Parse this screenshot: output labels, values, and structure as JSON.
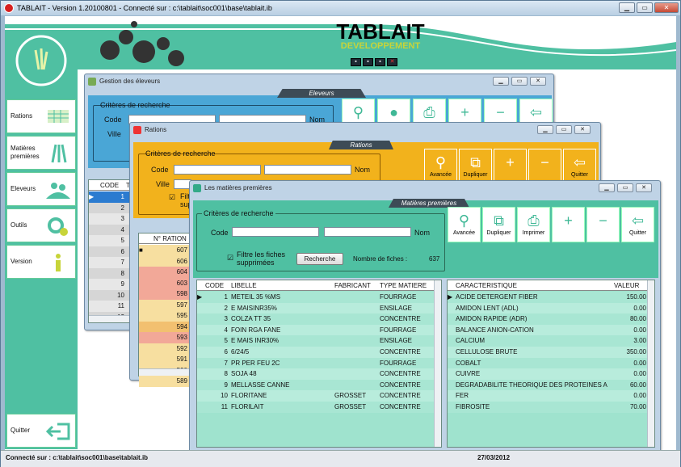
{
  "app": {
    "title": "TABLAIT - Version 1.20100801 - Connecté sur : c:\\tablait\\soc001\\base\\tablait.ib",
    "brand": "TABLAIT",
    "subtitle": "DEVELOPPEMENT",
    "accent_color": "#4fc0a2",
    "win_buttons": [
      "▁",
      "▭",
      "✕"
    ]
  },
  "sidebar": {
    "items": [
      {
        "label": "Rations",
        "icon": "grid-chart-icon"
      },
      {
        "label": "Matières premières",
        "icon": "wheat-icon"
      },
      {
        "label": "Eleveurs",
        "icon": "farmers-icon"
      },
      {
        "label": "Outils",
        "icon": "gears-icon"
      },
      {
        "label": "Version",
        "icon": "info-icon"
      }
    ],
    "quit_label": "Quitter"
  },
  "status": {
    "left": "Connecté sur : c:\\tablait\\soc001\\base\\tablait.ib",
    "date": "27/03/2012"
  },
  "eleveurs": {
    "title": "Gestion des éleveurs",
    "tab": "Eleveurs",
    "criteria": "Critères de recherche",
    "code_label": "Code",
    "ville_label": "Ville",
    "nom_label": "Nom",
    "grid_headers": [
      "CODE",
      "T"
    ],
    "rows": [
      "1",
      "2",
      "3",
      "4",
      "5",
      "6",
      "7",
      "8",
      "9",
      "10",
      "11",
      "12"
    ]
  },
  "rations": {
    "title": "Rations",
    "tab": "Rations",
    "criteria": "Critères de recherche",
    "code_label": "Code",
    "ville_label": "Ville",
    "nom_label": "Nom",
    "filter_label_1": "Filtr",
    "filter_label_2": "supp",
    "grid_header": "N° RATION",
    "rows": [
      "607",
      "606",
      "604",
      "603",
      "598",
      "597",
      "595",
      "594",
      "593",
      "592",
      "591",
      "590",
      "589"
    ],
    "btn_avancee": "Avancée",
    "btn_dupliquer": "Dupliquer",
    "btn_quitter": "Quitter"
  },
  "matieres": {
    "title": "Les matières premières",
    "tab": "Matières premières",
    "criteria": "Critères de recherche",
    "code_label": "Code",
    "nom_label": "Nom",
    "filter_label": "Filtre les fiches supprimées",
    "search_button": "Recherche",
    "count_label": "Nombre de fiches :",
    "count_value": "637",
    "buttons": {
      "avancee": "Avancée",
      "dupliquer": "Dupliquer",
      "imprimer": "Imprimer",
      "plus": "+",
      "minus": "−",
      "quitter": "Quitter"
    },
    "headers": [
      "CODE",
      "LIBELLE",
      "FABRICANT",
      "TYPE MATIERE"
    ],
    "rows": [
      [
        "1",
        "METEIL 35 %MS",
        "",
        "FOURRAGE"
      ],
      [
        "2",
        "E MAISINR35%",
        "",
        "ENSILAGE"
      ],
      [
        "3",
        "COLZA TT 35",
        "",
        "CONCENTRE"
      ],
      [
        "4",
        "FOIN RGA FANE",
        "",
        "FOURRAGE"
      ],
      [
        "5",
        "E MAIS INR30%",
        "",
        "ENSILAGE"
      ],
      [
        "6",
        "6/24/5",
        "",
        "CONCENTRE"
      ],
      [
        "7",
        "PR PER FEU 2C",
        "",
        "FOURRAGE"
      ],
      [
        "8",
        "SOJA 48",
        "",
        "CONCENTRE"
      ],
      [
        "9",
        "MELLASSE CANNE",
        "",
        "CONCENTRE"
      ],
      [
        "10",
        "FLORITANE",
        "GROSSET",
        "CONCENTRE"
      ],
      [
        "11",
        "FLORILAIT",
        "GROSSET",
        "CONCENTRE"
      ]
    ],
    "carac_headers": [
      "CARACTERISTIQUE",
      "VALEUR"
    ],
    "carac_rows": [
      [
        "ACIDE DETERGENT FIBER",
        "150.00"
      ],
      [
        "AMIDON LENT (ADL)",
        "0.00"
      ],
      [
        "AMIDON RAPIDE (ADR)",
        "80.00"
      ],
      [
        "BALANCE ANION-CATION",
        "0.00"
      ],
      [
        "CALCIUM",
        "3.00"
      ],
      [
        "CELLULOSE BRUTE",
        "350.00"
      ],
      [
        "COBALT",
        "0.00"
      ],
      [
        "CUIVRE",
        "0.00"
      ],
      [
        "DEGRADABILITE THEORIQUE DES PROTEINES A",
        "60.00"
      ],
      [
        "FER",
        "0.00"
      ],
      [
        "FIBROSITE",
        "70.00"
      ]
    ]
  }
}
